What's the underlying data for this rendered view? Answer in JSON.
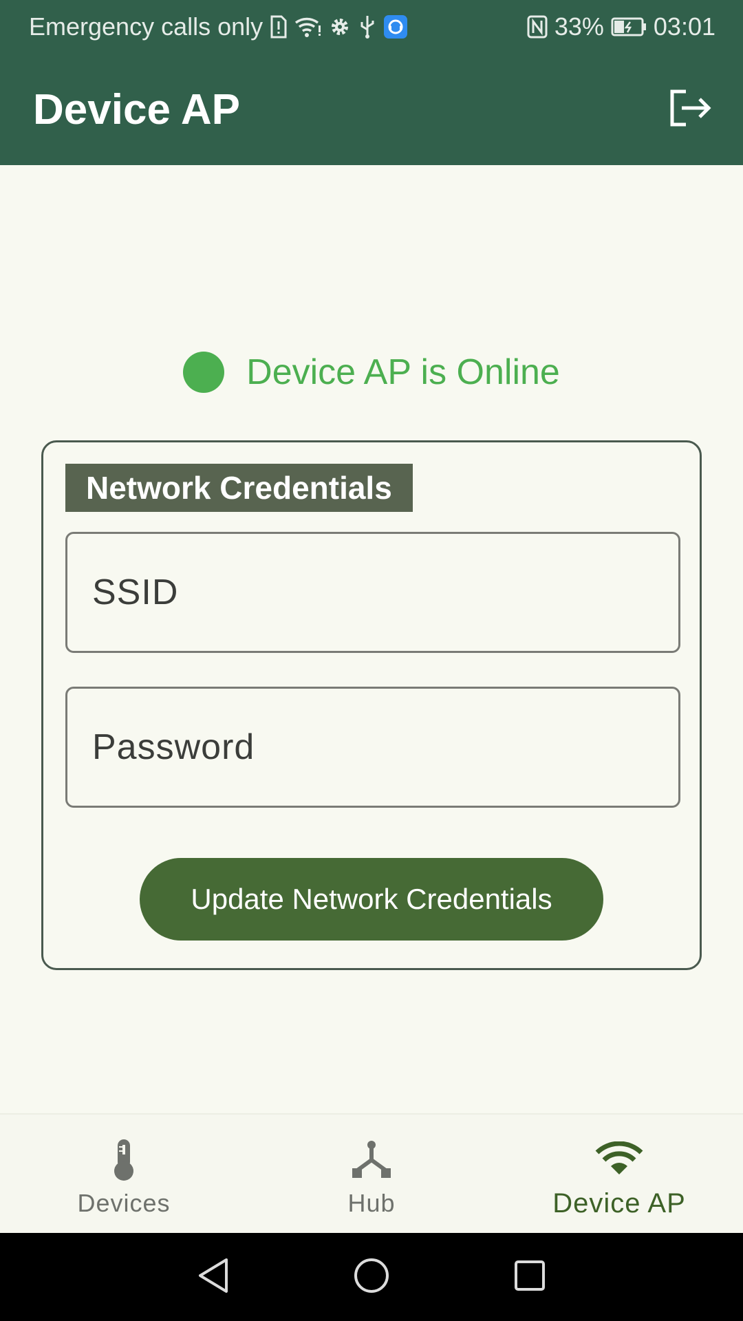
{
  "status_bar": {
    "carrier": "Emergency calls only",
    "battery": "33%",
    "time": "03:01",
    "icons": [
      "sim-alert-icon",
      "wifi-icon",
      "settings-icon",
      "usb-icon",
      "assistant-app-icon",
      "nfc-icon",
      "battery-charging-icon"
    ]
  },
  "app_bar": {
    "title": "Device AP",
    "action_icon": "logout-icon"
  },
  "status": {
    "text": "Device AP is Online",
    "color": "#4caf50"
  },
  "form": {
    "section_title": "Network Credentials",
    "ssid_placeholder": "SSID",
    "password_placeholder": "Password",
    "submit_label": "Update Network Credentials"
  },
  "bottom_nav": {
    "items": [
      {
        "label": "Devices",
        "icon": "thermometer-icon",
        "active": false
      },
      {
        "label": "Hub",
        "icon": "hub-icon",
        "active": false
      },
      {
        "label": "Device AP",
        "icon": "wifi-icon",
        "active": true
      }
    ]
  },
  "system_nav": {
    "icons": [
      "back-icon",
      "home-icon",
      "recents-icon"
    ]
  },
  "colors": {
    "primary": "#31604b",
    "accent": "#466a35",
    "online": "#4caf50",
    "background": "#f8f9f1"
  }
}
